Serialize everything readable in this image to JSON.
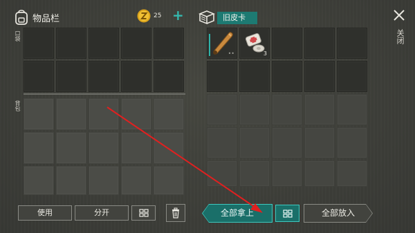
{
  "inventory": {
    "title": "物品栏",
    "pocket_label": "口袋",
    "backpack_label": "背包"
  },
  "currency": {
    "amount": "25",
    "icon": "z-coin-icon",
    "add_icon": "plus-icon"
  },
  "container": {
    "name": "旧皮卡",
    "icon": "cardboard-box-icon"
  },
  "close": {
    "label": "关闭",
    "icon": "close-icon"
  },
  "container_items": [
    {
      "name": "baseball-bat",
      "count": ""
    },
    {
      "name": "bandage",
      "count": "3"
    }
  ],
  "buttons": {
    "use": "使用",
    "split": "分开",
    "take_all": "全部拿上",
    "put_all": "全部放入",
    "sort_icon": "sort-grid-icon",
    "trash_icon": "trash-icon"
  },
  "colors": {
    "accent": "#1d7a72",
    "accent_bright": "#3ec9bf",
    "annotation_arrow": "#e02020"
  }
}
